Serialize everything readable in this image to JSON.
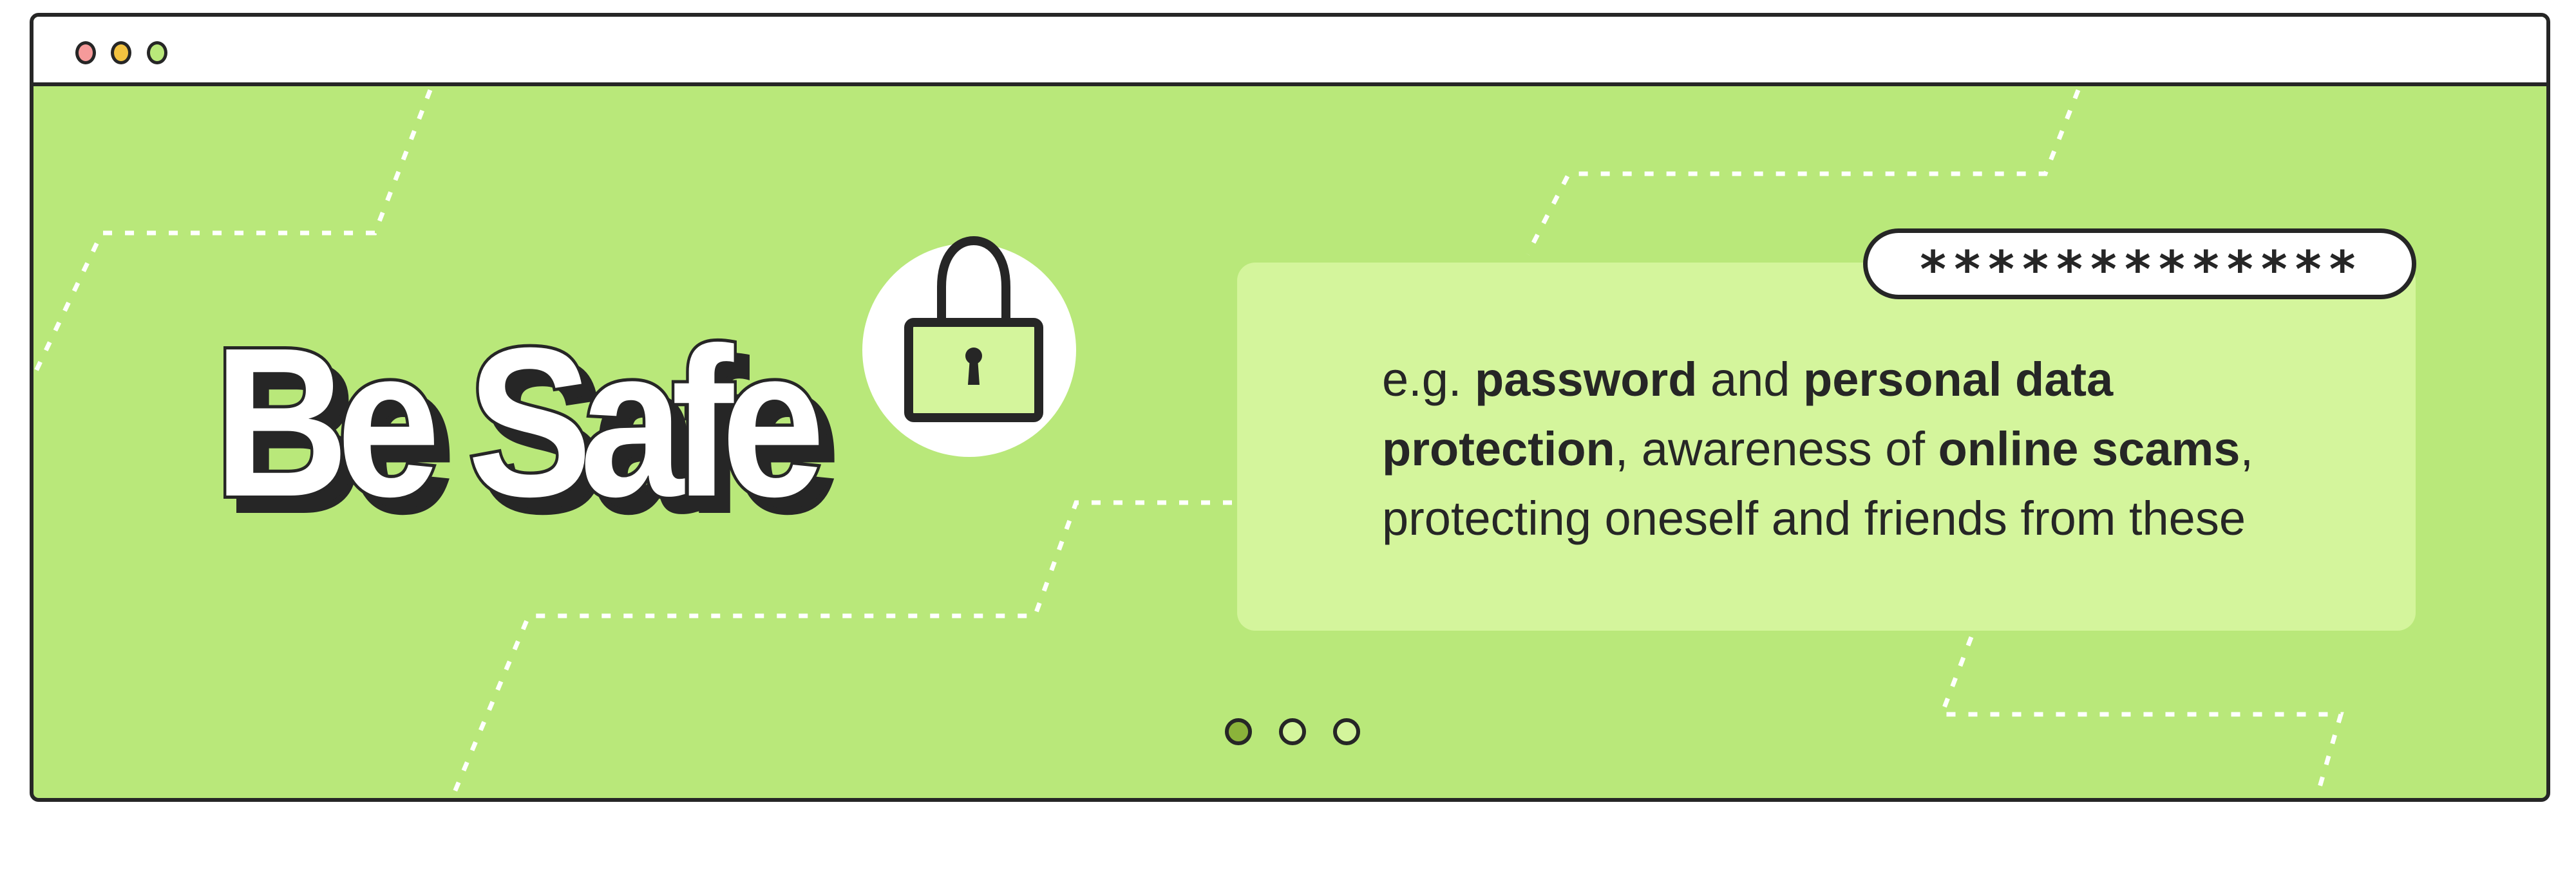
{
  "window": {
    "controls": [
      {
        "name": "close",
        "color": "#f59a9a"
      },
      {
        "name": "minimize",
        "color": "#f2c240"
      },
      {
        "name": "maximize",
        "color": "#b9e87a"
      }
    ]
  },
  "hero": {
    "title": "Be Safe",
    "icon": "padlock-icon"
  },
  "password_field": {
    "value": "*************"
  },
  "card": {
    "segments": [
      {
        "text": "e.g. ",
        "bold": false
      },
      {
        "text": "password",
        "bold": true
      },
      {
        "text": " and ",
        "bold": false
      },
      {
        "text": "personal data protection",
        "bold": true
      },
      {
        "text": ", awareness of ",
        "bold": false
      },
      {
        "text": "online scams",
        "bold": true
      },
      {
        "text": ", protecting oneself and friends from these",
        "bold": false
      }
    ]
  },
  "pagination": {
    "total": 3,
    "active": 1
  },
  "colors": {
    "background": "#b9e87a",
    "card": "#d4f59c",
    "ink": "#262626",
    "active_dot": "#8bb33a"
  }
}
